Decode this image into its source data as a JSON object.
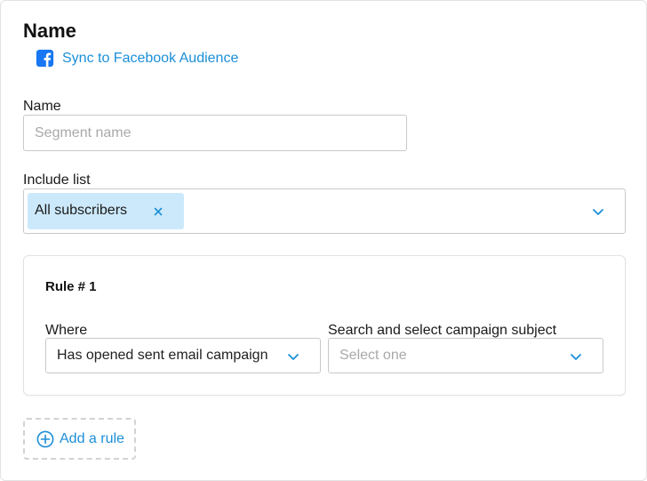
{
  "header": {
    "title": "Name",
    "sync_link_label": "Sync to Facebook Audience"
  },
  "name_field": {
    "label": "Name",
    "value": "",
    "placeholder": "Segment name"
  },
  "include_list": {
    "label": "Include list",
    "selected": [
      {
        "label": "All subscribers",
        "remove_glyph": "×"
      }
    ]
  },
  "rules": [
    {
      "title": "Rule # 1",
      "where": {
        "label": "Where",
        "value": "Has opened sent email campaign"
      },
      "campaign_subject": {
        "label": "Search and select campaign subject",
        "placeholder": "Select one"
      }
    }
  ],
  "actions": {
    "add_rule_label": "Add a rule"
  },
  "icons": {
    "sync": "facebook-icon",
    "dropdown": "chevron-down-icon",
    "remove": "close-icon",
    "add": "plus-circle-icon"
  },
  "colors": {
    "accent": "#1b8fd8",
    "facebook": "#1877f2",
    "chip_background": "#cce9fb",
    "border": "#c9c9c9",
    "placeholder": "#a9a9a9"
  }
}
